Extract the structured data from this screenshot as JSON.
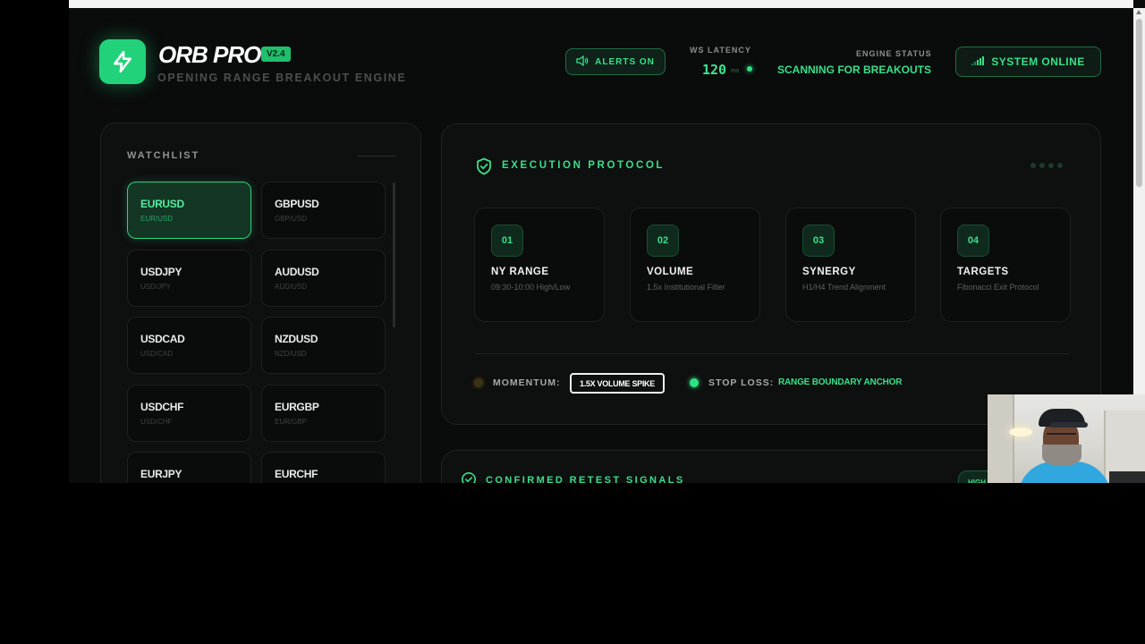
{
  "header": {
    "brand": "ORB PRO",
    "version": "V2.4",
    "subtitle": "OPENING RANGE BREAKOUT ENGINE",
    "alerts_label": "ALERTS ON",
    "ws_latency_label": "WS LATENCY",
    "ws_latency_value": "120",
    "ws_latency_unit": "ms",
    "engine_status_label": "ENGINE STATUS",
    "engine_status_value": "SCANNING FOR BREAKOUTS",
    "system_status": "SYSTEM ONLINE"
  },
  "watchlist": {
    "title": "WATCHLIST",
    "pairs": [
      {
        "symbol": "EURUSD",
        "sub": "EUR/USD",
        "active": true
      },
      {
        "symbol": "GBPUSD",
        "sub": "GBP/USD",
        "active": false
      },
      {
        "symbol": "USDJPY",
        "sub": "USD/JPY",
        "active": false
      },
      {
        "symbol": "AUDUSD",
        "sub": "AUD/USD",
        "active": false
      },
      {
        "symbol": "USDCAD",
        "sub": "USD/CAD",
        "active": false
      },
      {
        "symbol": "NZDUSD",
        "sub": "NZD/USD",
        "active": false
      },
      {
        "symbol": "USDCHF",
        "sub": "USD/CHF",
        "active": false
      },
      {
        "symbol": "EURGBP",
        "sub": "EUR/GBP",
        "active": false
      },
      {
        "symbol": "EURJPY",
        "sub": "",
        "active": false
      },
      {
        "symbol": "EURCHF",
        "sub": "",
        "active": false
      }
    ]
  },
  "execution": {
    "title": "EXECUTION PROTOCOL",
    "steps": [
      {
        "num": "01",
        "name": "NY RANGE",
        "desc": "09:30-10:00 High/Low"
      },
      {
        "num": "02",
        "name": "VOLUME",
        "desc": "1.5x Institutional Filter"
      },
      {
        "num": "03",
        "name": "SYNERGY",
        "desc": "H1/H4 Trend Alignment"
      },
      {
        "num": "04",
        "name": "TARGETS",
        "desc": "Fibonacci Exit Protocol"
      }
    ],
    "momentum_label": "MOMENTUM:",
    "momentum_value": "1.5X VOLUME SPIKE",
    "stop_loss_label": "STOP LOSS:",
    "stop_loss_value": "RANGE BOUNDARY ANCHOR"
  },
  "retest": {
    "title": "CONFIRMED RETEST SIGNALS",
    "badge": "HIGH"
  },
  "colors": {
    "accent": "#36e08a",
    "background": "#0a0b0b",
    "panel": "#0e0f0f"
  },
  "icons": {
    "logo": "lightning-bolt-icon",
    "alerts": "speaker-icon",
    "system": "signal-bars-icon",
    "execution": "shield-check-icon",
    "retest": "check-circle-icon"
  }
}
